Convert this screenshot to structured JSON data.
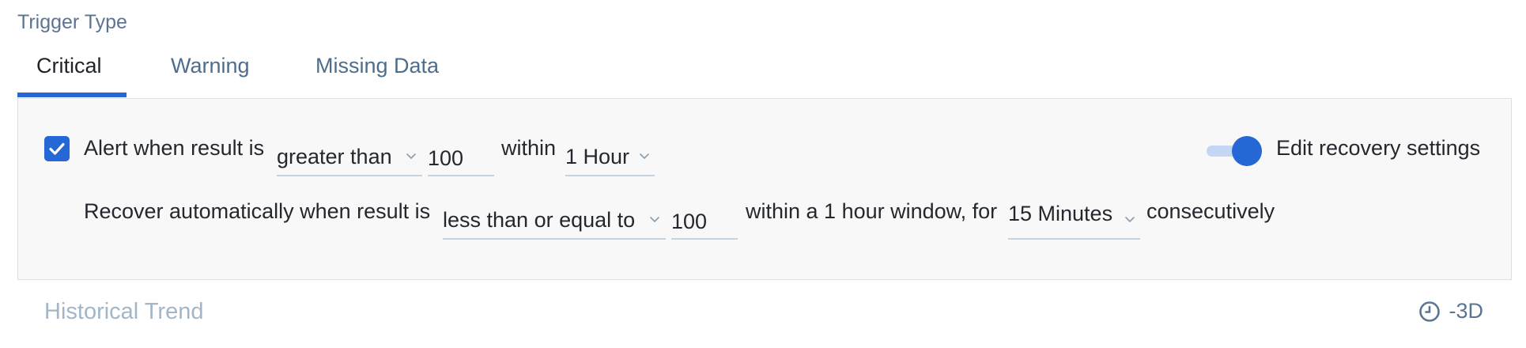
{
  "section": {
    "label": "Trigger Type"
  },
  "tabs": [
    {
      "label": "Critical"
    },
    {
      "label": "Warning"
    },
    {
      "label": "Missing Data"
    }
  ],
  "alert_row": {
    "prefix": "Alert when result is",
    "comparator": "greater than",
    "threshold": "100",
    "within_label": "within",
    "window": "1 Hour"
  },
  "recovery_toggle": {
    "label": "Edit recovery settings",
    "enabled": true
  },
  "recover_row": {
    "prefix": "Recover automatically when result is",
    "comparator": "less than or equal to",
    "threshold": "100",
    "window_text": "within a 1 hour window, for",
    "duration": "15 Minutes",
    "suffix": "consecutively"
  },
  "historical": {
    "title": "Historical Trend",
    "range": "-3D"
  },
  "colors": {
    "accent": "#2667d6",
    "muted_label": "#5b7591",
    "panel_bg": "#f8f8f8"
  },
  "icons": {
    "checkbox": "check-icon",
    "chevron": "chevron-down-icon",
    "clock": "clock-icon"
  }
}
